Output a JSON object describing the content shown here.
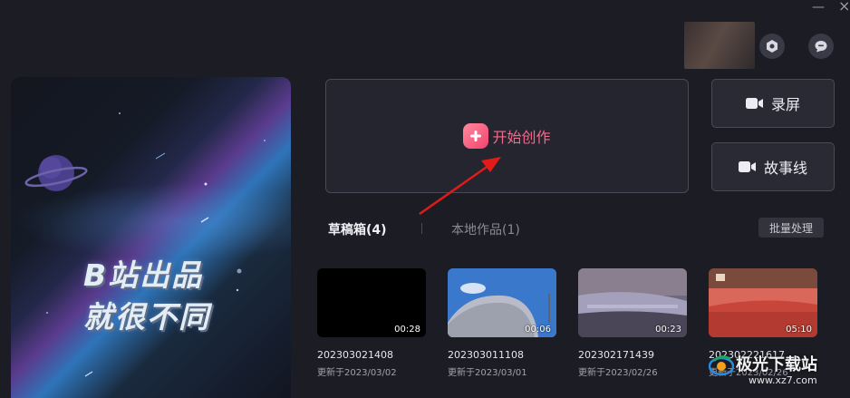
{
  "window": {
    "minimize": "—",
    "close": "×"
  },
  "banner": {
    "line1": "B站出品",
    "line2": "就很不同"
  },
  "start": {
    "label": "开始创作"
  },
  "side_buttons": {
    "record": "录屏",
    "story": "故事线"
  },
  "tabs": {
    "drafts": "草稿箱(4)",
    "local": "本地作品(1)",
    "batch": "批量处理"
  },
  "drafts": [
    {
      "name": "202303021408",
      "updated": "更新于2023/03/02",
      "duration": "00:28"
    },
    {
      "name": "202303011108",
      "updated": "更新于2023/03/01",
      "duration": "00:06"
    },
    {
      "name": "202302171439",
      "updated": "更新于2023/02/26",
      "duration": "00:23"
    },
    {
      "name": "202302221617",
      "updated": "更新于2023/02/26",
      "duration": "05:10"
    }
  ],
  "watermark": {
    "text": "极光下载站",
    "url": "www.xz7.com"
  },
  "colors": {
    "background": "#1c1c25",
    "accent": "#f7688b",
    "arrow": "#e11a1a"
  }
}
